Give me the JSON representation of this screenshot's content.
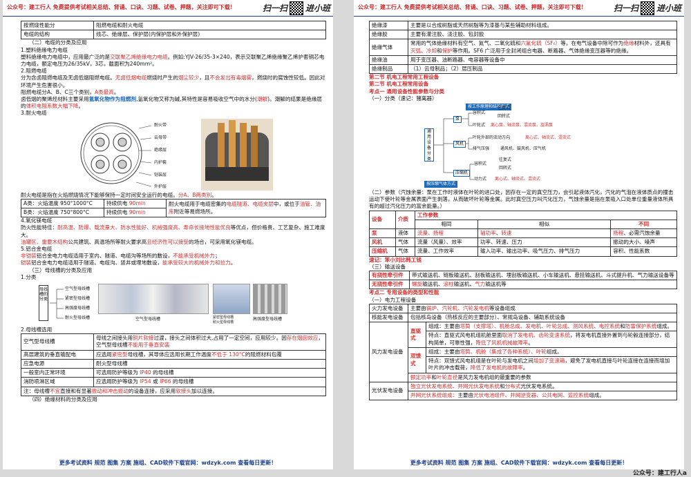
{
  "header": {
    "text": "公众号：建工行人 免费提供考试相关总结、背诵、口诀、习题、试卷、押题，关注即可下载！",
    "brand_left": "扫一扫",
    "brand_right": "进小班"
  },
  "footer": {
    "text": "更多考试资料 规范 图集 方案 施组、CAD软件下载官网：wdzyk.com 查看每日更新！"
  },
  "outer_footer": "公众号：建工行人a",
  "p1": {
    "t1": [
      [
        "按燃烧性能分",
        "阻燃电缆和耐火电缆"
      ],
      [
        "电缆的结构",
        "线芯、绝缘层、保护层(内保护层和外保护层)"
      ]
    ],
    "s_cable": "（二）电缆的分类及应用",
    "h1": "1.塑料绝缘电力电缆",
    "l1a": "塑料绝缘电力电缆中，应用最广泛的是",
    "l1b": "交联聚乙烯绝缘电力电缆",
    "l1c": "。例如:YJV-26/35-3×240，表示交联聚乙烯绝缘聚乙烯护套铜芯电力电缆，额定电压为26/35kV，3芯，截面积为240mm²。",
    "h2": "2.阻燃电缆",
    "l2a": "分为含卤阻燃电缆及无卤低烟阻燃电缆。",
    "l2b": "无卤低烟电缆",
    "l2c": "燃烧时产生的",
    "l2d": "烟尘较少",
    "l2e": "，且",
    "l2f": "不会发出有毒烟雾",
    "l2g": "，燃烧时的腐蚀性较低。因此对环境产生危害很小。",
    "l2h": "阻燃电缆分A、B、C三个类别，",
    "l2i": "A类最高",
    "l2j": "。",
    "l2k": "卤低烟的聚烯烃材料主要采用",
    "l2l": "氢氧化物作为阻燃剂",
    "l2m": ",氢氧化物又称为碱,其特性是容易吸收空气中的水分(",
    "l2n": "潮解",
    "l2o": ")。潮解的结果是绝缘层的",
    "l2p": "体积电阻系数大幅下降",
    "l2q": "。",
    "h3": "3.耐火电缆",
    "fig_labels": [
      "耐火带",
      "云母带",
      "绝缘层",
      "内护套",
      "铠装层",
      "外护层"
    ],
    "fire_a": "耐火电缆是指在火焰燃烧情况下能够保持一定时间安全运行的电缆。",
    "fire_b": "分A、B两类别",
    "fire_c": "。",
    "t2": {
      "r1c1": "A类：火焰温度 950°1000°C",
      "r1c2a": "持续供电 ",
      "r1c2b": "90min",
      "r2c1": "B类：火焰温度 750°800°C",
      "r2c2a": "持续供电 ",
      "r2c2b": "90min",
      "c3a": "耐火电缆用于电缆密集的",
      "c3b": "电缆隧道、电缆夹层",
      "c3c": "中，或位于",
      "c3d": "油管、油库",
      "c3e": "附近等易燃场所。"
    },
    "h4": "4.氧化镁电缆",
    "l4a": "防火性能特佳：",
    "l4b": "耐高温、防爆、载流量大、防水性能好、机械强度高、寿命长接地性能优良",
    "l4c": "等优点，但价格贵、工艺复杂、施工难度大。",
    "l4d": "油罐区、重要木结构",
    "l4e": "公共建筑、高温场所等耐火要求高",
    "l4f": "且经济性可以接受",
    "l4g": "的场合，可采用氧化镁电缆。",
    "h5": "5.铝合金电缆",
    "l5a": "非铠装",
    "l5b": "铝合金电力电缆适用于室内、隧道、电缆沟等场所的敷设，",
    "l5c": "不能承受机械外力",
    "l5d": "；",
    "l5e": "铠装",
    "l5f": "铝合金电力电缆适用于隧道、电缆沟、竖井或埋地敷设，",
    "l5g": "能承受较大的机械外力和拉力",
    "l5h": "。",
    "s_bus": "（三）母线槽的分类及应用",
    "h_bus1": "1.分类",
    "bus_root": "母线槽的分类",
    "bus_items": [
      "空气型母线槽",
      "紧密型母线槽",
      "高强度母线槽",
      "耐火型母线槽"
    ],
    "bus_caps": [
      "空气型母线槽",
      "紧密型母线槽",
      "耐火型母线槽",
      "高强度型母线槽"
    ],
    "h_bus2": "2.母线槽选用",
    "t3": [
      {
        "k": "空气型母线槽",
        "v": [
          [
            "母线之间接头用",
            ""
          ],
          [
            "铜片软接",
            "red"
          ],
          [
            "过渡，接头之间体积过大,占用了一定空间，应用较少。因",
            ""
          ],
          [
            "存在烟囱效应",
            "red"
          ],
          [
            "，空气型母线槽",
            ""
          ],
          [
            "不能用于垂直安装",
            "red"
          ]
        ]
      },
      {
        "k": "高层建筑的垂直输配电",
        "v": [
          [
            "应选用",
            ""
          ],
          [
            "紧密型",
            "red"
          ],
          [
            "母线槽，其导体应选用长期工作温度",
            ""
          ],
          [
            "不低于 130°C",
            "red"
          ],
          [
            "的阻燃材料包覆",
            ""
          ]
        ]
      },
      {
        "k": "应急电源",
        "v": [
          [
            "耐火型母线槽",
            ""
          ]
        ]
      },
      {
        "k": "一般室内正常环境",
        "v": [
          [
            "可选用防护等级为 ",
            ""
          ],
          [
            "IP40",
            "red"
          ],
          [
            " 的母线槽",
            ""
          ]
        ]
      },
      {
        "k": "消防喷淋区域",
        "v": [
          [
            "应选用防护等级为 ",
            ""
          ],
          [
            "IP54",
            "red"
          ],
          [
            " 或 ",
            ""
          ],
          [
            "IP66",
            "red"
          ],
          [
            " 的母线槽",
            ""
          ]
        ]
      }
    ],
    "t3note": [
      [
        "注：母线槽",
        ""
      ],
      [
        "不宜",
        "red"
      ],
      [
        "直接和有显著",
        ""
      ],
      [
        "振动和冲击振动",
        "red"
      ],
      [
        "的设备连接，应采用",
        ""
      ],
      [
        "软接头",
        "red"
      ],
      [
        "加以连接。",
        ""
      ]
    ],
    "s_ins": "（四）绝缘材料的分类及应用"
  },
  "p2": {
    "t1": [
      {
        "k": "绝缘漆",
        "v": [
          [
            "主要是以合成树脂或天然树脂等为漆基与某些辅助材料组成。",
            ""
          ]
        ]
      },
      {
        "k": "绝缘胶",
        "v": [
          [
            "主要有灌注胶、浇注胶、包封胶",
            ""
          ]
        ]
      },
      {
        "k": "绝缘气体",
        "v": [
          [
            "常用的气体绝缘材料有空气、氮气、二氧化硫和",
            ""
          ],
          [
            "六氟化硫（SF₆）",
            "red"
          ],
          [
            "等。在电气设备中除可作为",
            ""
          ],
          [
            "绝缘",
            "red"
          ],
          [
            "材料外，还具有",
            ""
          ],
          [
            "灭弧、冷却",
            "red"
          ],
          [
            "和",
            ""
          ],
          [
            "保护",
            "red"
          ],
          [
            "等作用。SF6 广泛用于全封闭组合电器、断路器、气体绝缘变压器等的绝缘。",
            ""
          ]
        ]
      },
      {
        "k": "绝缘油",
        "v": [
          [
            "用于变压器、油断路器、电容器等设备中",
            ""
          ]
        ]
      },
      {
        "k": "绝缘制品",
        "v": [
          [
            "（1）云母制品；（2）层压制品",
            ""
          ]
        ]
      }
    ],
    "sec2": "第二节 机电工程常用工程设备",
    "sec2a": "第二节 机电工程常用设备",
    "kp1": "考点一 通用设备性能参数与分类",
    "cls": "（一）分类（速记：猪离器）",
    "map": {
      "top": "按工作原理和结构形式",
      "bottom": "按压缩气体方式",
      "root": "通用设备分类",
      "l1": [
        "泵",
        "风机",
        "压缩机"
      ],
      "pump": [
        "容积式",
        "叶轮式"
      ],
      "pump_a": [
        "往复式",
        "回转式"
      ],
      "pump_b": [
        "离心泵、轴流泵、混流泵、旋涡泵"
      ],
      "fan": [
        "叶轮外部的流动方向",
        "排气压强"
      ],
      "fan_a": [
        "离心式、轴流式、混流式"
      ],
      "fan_b": [
        "通风机、鼓风机、压气机"
      ],
      "comp": [
        "容积式",
        "动力式"
      ],
      "comp_a": [
        "往复式",
        "回转式"
      ],
      "comp_b": [
        "离心式、轴流式、混流式"
      ]
    },
    "param_a": "（二）参数（汽蚀余量：泵在工作时液体在叶轮的进口处，因存在一定的真空压力，会引起液体汽化，汽化的气泡在液体质点的撞击运动下使叶轮等金属表面产生剥落，从而破坏叶轮等金属。此时真空压力叫汽化压力，气蚀余量是指在泵吸入口处单位重量液体所具有的超过汽化压力的富余能量。）",
    "t2": {
      "h": [
        "设备",
        "介质",
        "工作参数"
      ],
      "sub": [
        "相同",
        "相似",
        "不同"
      ],
      "rows": [
        [
          [
            "泵",
            "red"
          ],
          "液体",
          [
            [
              "流量",
              "red"
            ],
            [
              "、扬程",
              "red"
            ]
          ],
          [
            [
              "轴功率",
              "red"
            ],
            [
              "、",
              ""
            ],
            [
              "转速",
              "red"
            ]
          ],
          [
            [
              "扬程",
              "red"
            ],
            [
              "、必需汽蚀余量",
              ""
            ]
          ]
        ],
        [
          [
            "风机",
            "red"
          ],
          "气体",
          [
            [
              "流量（风量）、效率",
              ""
            ]
          ],
          [
            [
              "功率、转速、压力",
              ""
            ]
          ],
          [
            [
              "振动的大小、噪声",
              ""
            ]
          ]
        ],
        [
          [
            "压缩机",
            "red"
          ],
          "气体",
          [
            [
              "流量、工作效率",
              ""
            ]
          ],
          [
            [
              "输入功率、输出功率、吸气压力、排气压力",
              ""
            ]
          ],
          [
            [
              "容积、性能系数",
              ""
            ]
          ]
        ]
      ]
    },
    "memo": "速记：笨小刘比韩工钱",
    "conv": "（三）输送设备",
    "t3": [
      {
        "k": "有挠性牵引件",
        "v": [
          [
            "带式输送机、链板输送机、刮板输送机、埋刮板输送机、小车输送机、悬挂输送机、斗式提升机、气力输送设备等",
            ""
          ]
        ]
      },
      {
        "k": "无挠性牵引件",
        "v": [
          [
            "螺旋",
            "red"
          ],
          [
            "输送机、",
            ""
          ],
          [
            "滚柱",
            "red"
          ],
          [
            "输送机、",
            ""
          ],
          [
            "气力",
            "red"
          ],
          [
            "输送机等",
            ""
          ]
        ]
      }
    ],
    "kp2": "考点二 专用设备的类型和性能",
    "kp2a": "（一）电力工程设备",
    "t4": {
      "r1k": "火力发电设备",
      "r1v": [
        [
          "主要由",
          ""
        ],
        [
          "锅炉、汽轮机、汽轮发电机",
          "red"
        ],
        [
          "等设备组成",
          ""
        ]
      ],
      "r2k": "核能发电设备",
      "r2v": [
        [
          "包括核岛设备（热核反应的主要部分）、常规岛设备、辅助系统设备",
          ""
        ]
      ],
      "wind": "风力发电设备",
      "zq": "直驱式",
      "sk": "双馈式",
      "zq1": [
        [
          "组成：主要由",
          ""
        ],
        [
          "塔筒（支撑塔）、机舱总成、发电机、叶轮总成、测风系统、电控系统",
          "red"
        ],
        [
          "和",
          ""
        ],
        [
          "防雷保护系统",
          "red"
        ],
        [
          "组成。",
          ""
        ]
      ],
      "zq2": [
        [
          "特点：直驱式风电机组机舱里面",
          ""
        ],
        [
          "取消了发电机、齿轮变速系统",
          "red"
        ],
        [
          "，将发电机直接外置到与轮毂连接部分，结构简单，可靠性强，",
          ""
        ],
        [
          "降低了风机机械故障率",
          "red"
        ],
        [
          "。",
          ""
        ]
      ],
      "sk1": [
        [
          "组成：主要由",
          ""
        ],
        [
          "塔筒、机舱（集成了各种系统）、叶轮",
          "red"
        ],
        [
          "组成。",
          ""
        ]
      ],
      "sk2": [
        [
          "特点：双馈式风电机组是在叶轮与发电机之间",
          ""
        ],
        [
          "增加了变速箱",
          "red"
        ],
        [
          "，避免了发电机直接与叶轮连接在连接而增加叶片的冲击载荷，",
          ""
        ],
        [
          "降低了发电机的故障率",
          "red"
        ],
        [
          "。",
          ""
        ]
      ],
      "wnote": [
        [
          "额定功率",
          "red"
        ],
        [
          "和",
          ""
        ],
        [
          "叶轮直径",
          "red"
        ],
        [
          "是风力发电机组的最重要的参数",
          ""
        ]
      ],
      "pv": "光伏发电设备",
      "pv1": [
        [
          "独立光伏发电系统、并网光伏发电系统",
          "red"
        ],
        [
          "和",
          ""
        ],
        [
          "分布式",
          "red"
        ],
        [
          "光伏发电系统。",
          ""
        ]
      ],
      "pv2": [
        [
          "并网光伏系统组成：",
          "red"
        ],
        [
          "主要由",
          ""
        ],
        [
          "光伏电池组件、并网逆变器、公共电网、监控系统",
          "red"
        ],
        [
          "组成。",
          ""
        ]
      ]
    }
  }
}
